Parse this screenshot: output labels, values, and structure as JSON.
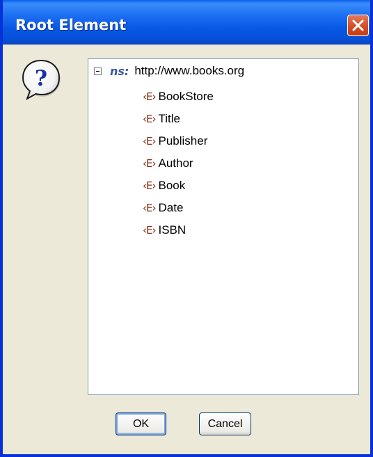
{
  "window": {
    "title": "Root Element"
  },
  "tree": {
    "namespace": {
      "prefix": "ns:",
      "uri": "http://www.books.org"
    },
    "element_icon": "‹E›",
    "elements": [
      {
        "label": "BookStore"
      },
      {
        "label": "Title"
      },
      {
        "label": "Publisher"
      },
      {
        "label": "Author"
      },
      {
        "label": "Book"
      },
      {
        "label": "Date"
      },
      {
        "label": "ISBN"
      }
    ]
  },
  "buttons": {
    "ok_label": "OK",
    "cancel_label": "Cancel"
  },
  "icons": {
    "dialog": "question-mark-balloon-icon",
    "close": "close-icon",
    "element": "xml-element-icon",
    "collapse": "collapse-minus-icon"
  },
  "colors": {
    "titlebar": "#0a5fee",
    "frame": "#0831d9",
    "dialog_bg": "#ece9d8",
    "close_button": "#d24a21",
    "ns_prefix": "#3b54a6",
    "element_icon": "#8b2a12"
  }
}
